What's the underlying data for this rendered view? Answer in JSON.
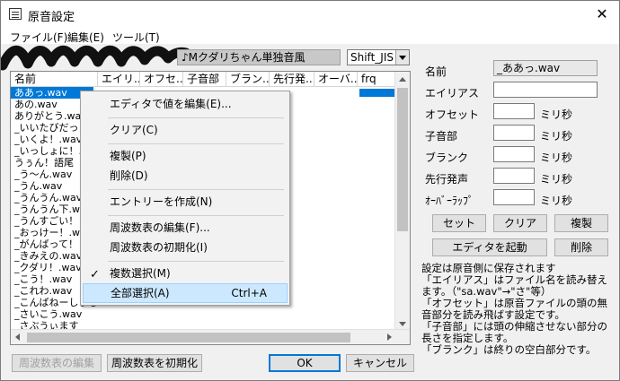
{
  "window": {
    "title": "原音設定",
    "close_glyph": "✕"
  },
  "menu": {
    "items": [
      "ファイル(F)",
      "編集(E)",
      "ツール(T)"
    ]
  },
  "voicebank_name": "♪Mクダリちゃん単独音風",
  "encoding": {
    "selected": "Shift_JIS"
  },
  "list": {
    "columns": [
      "名前",
      "エイリ...",
      "オフセ...",
      "子音部",
      "ブラン...",
      "先行発...",
      "オーバ...",
      "frq"
    ],
    "rows": [
      "ああっ.wav",
      "あの.wav",
      "ありがとう.wav",
      "_いいたびだっ",
      "_いくよ！.wav",
      "_いっしょに！.w",
      "うぅん！語尾",
      "_う～ん.wav",
      "_うん.wav",
      "_うんうん.wav",
      "_うんうん下.wa",
      "_うんすごい！",
      "_おっけー！.wa",
      "_がんばって！",
      "_きみえの.wav",
      "_クダリ！.wav",
      "_こう！.wav",
      "_これわ.wav",
      "_こんばねーしまし",
      "_さいこう.wav",
      "_さぶうぃます"
    ],
    "selected_index": 0
  },
  "context_menu": {
    "items": [
      {
        "label": "エディタで値を編集(E)..."
      },
      {
        "label": "クリア(C)"
      },
      {
        "label": "複製(P)"
      },
      {
        "label": "削除(D)"
      },
      {
        "label": "エントリーを作成(N)"
      },
      {
        "label": "周波数表の編集(F)..."
      },
      {
        "label": "周波数表の初期化(I)"
      },
      {
        "label": "複数選択(M)",
        "checked": true
      },
      {
        "label": "全部選択(A)",
        "shortcut": "Ctrl+A",
        "highlighted": true
      }
    ]
  },
  "fields": {
    "name": {
      "label": "名前",
      "value": "_ああっ.wav"
    },
    "alias": {
      "label": "エイリアス",
      "value": ""
    },
    "offset": {
      "label": "オフセット",
      "value": "",
      "unit": "ミリ秒"
    },
    "consonant": {
      "label": "子音部",
      "value": "",
      "unit": "ミリ秒"
    },
    "blank": {
      "label": "ブランク",
      "value": "",
      "unit": "ミリ秒"
    },
    "preutterance": {
      "label": "先行発声",
      "value": "",
      "unit": "ミリ秒"
    },
    "overlap": {
      "label": "ｵｰﾊﾞｰﾗｯﾌﾟ",
      "value": "",
      "unit": "ミリ秒"
    }
  },
  "buttons": {
    "set": "セット",
    "clear": "クリア",
    "duplicate": "複製",
    "launch_editor": "エディタを起動",
    "delete": "削除",
    "freq_edit": "周波数表の編集",
    "freq_init": "周波数表を初期化",
    "ok": "OK",
    "cancel": "キャンセル"
  },
  "help": {
    "lines": [
      "設定は原音側に保存されます",
      "「エイリアス」はファイル名を読み替えます。（\"sa.wav\"→\"さ\"等）",
      "「オフセット」は原音ファイルの頭の無音部分を読み飛ばす設定です。",
      "「子音部」には頭の伸縮させない部分の長さを指定します。",
      "「ブランク」は終りの空白部分です。"
    ]
  },
  "colors": {
    "selection": "#0078d7",
    "menu_highlight": "#cce8ff",
    "dialog_bg": "#f0f0f0"
  }
}
